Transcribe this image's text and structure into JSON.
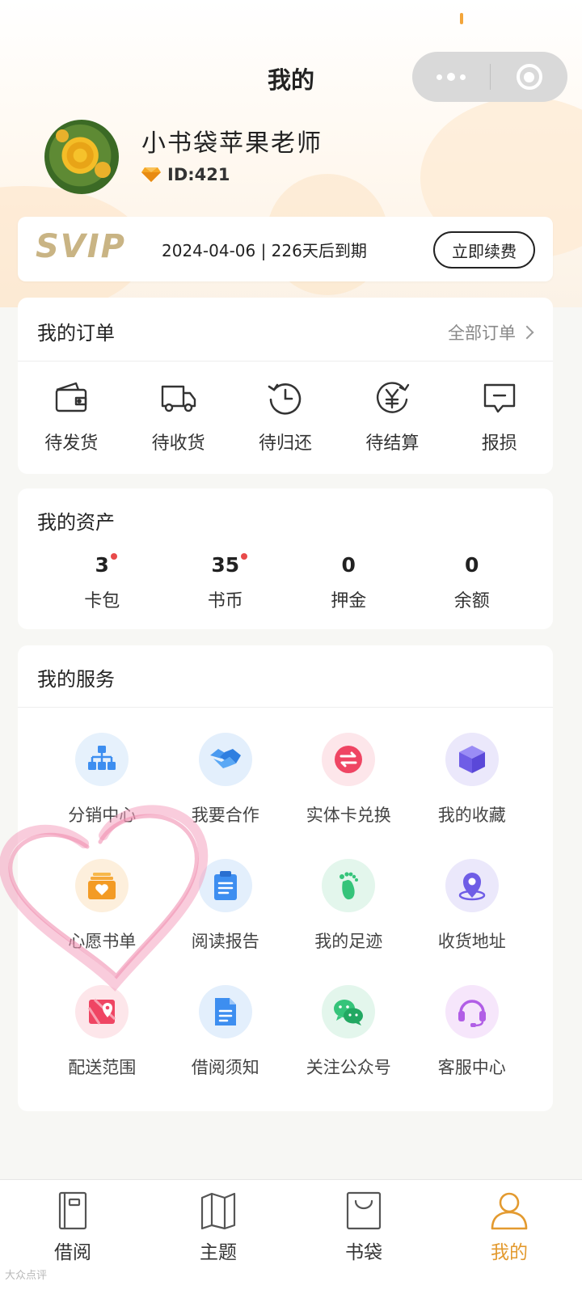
{
  "navbar": {
    "title": "我的"
  },
  "profile": {
    "name": "小书袋苹果老师",
    "id": "ID:421"
  },
  "svip": {
    "logo": "SVIP",
    "expiry": "2024-04-06 | 226天后到期",
    "renew_label": "立即续费"
  },
  "orders": {
    "title": "我的订单",
    "all_label": "全部订单",
    "items": [
      {
        "label": "待发货",
        "icon": "wallet-icon"
      },
      {
        "label": "待收货",
        "icon": "truck-icon"
      },
      {
        "label": "待归还",
        "icon": "clock-return-icon"
      },
      {
        "label": "待结算",
        "icon": "yen-refresh-icon"
      },
      {
        "label": "报损",
        "icon": "message-icon"
      }
    ]
  },
  "assets": {
    "title": "我的资产",
    "items": [
      {
        "value": "3",
        "label": "卡包",
        "has_dot": true
      },
      {
        "value": "35",
        "label": "书币",
        "has_dot": true
      },
      {
        "value": "0",
        "label": "押金",
        "has_dot": false
      },
      {
        "value": "0",
        "label": "余额",
        "has_dot": false
      }
    ]
  },
  "services": {
    "title": "我的服务",
    "items": [
      {
        "label": "分销中心",
        "icon": "org-chart-icon"
      },
      {
        "label": "我要合作",
        "icon": "handshake-icon"
      },
      {
        "label": "实体卡兑换",
        "icon": "exchange-icon"
      },
      {
        "label": "我的收藏",
        "icon": "cube-icon"
      },
      {
        "label": "心愿书单",
        "icon": "wish-box-icon"
      },
      {
        "label": "阅读报告",
        "icon": "clipboard-icon"
      },
      {
        "label": "我的足迹",
        "icon": "footprint-icon"
      },
      {
        "label": "收货地址",
        "icon": "location-icon"
      },
      {
        "label": "配送范围",
        "icon": "map-pin-icon"
      },
      {
        "label": "借阅须知",
        "icon": "document-icon"
      },
      {
        "label": "关注公众号",
        "icon": "wechat-icon"
      },
      {
        "label": "客服中心",
        "icon": "headset-icon"
      }
    ]
  },
  "tabbar": {
    "items": [
      {
        "label": "借阅",
        "icon": "book-icon"
      },
      {
        "label": "主题",
        "icon": "map-fold-icon"
      },
      {
        "label": "书袋",
        "icon": "bag-icon"
      },
      {
        "label": "我的",
        "icon": "person-icon"
      }
    ],
    "active_index": 3
  },
  "colors": {
    "accent": "#e39a2f",
    "red_dot": "#e84a4a",
    "svip_gold": "#c9b484"
  },
  "watermark": "大众点评"
}
